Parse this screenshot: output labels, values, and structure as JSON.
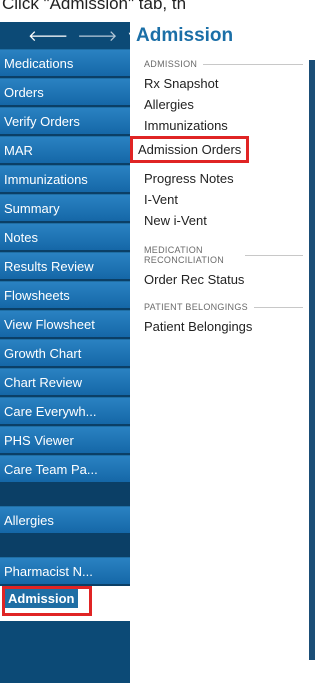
{
  "caption": "Click \"Admission\" tab, th",
  "leftnav": {
    "back_icon": "arrow-left",
    "forward_icon": "arrow-right",
    "menu_icon": "chevron-down",
    "items": [
      {
        "label": "Medications"
      },
      {
        "label": "Orders"
      },
      {
        "label": "Verify Orders"
      },
      {
        "label": "MAR"
      },
      {
        "label": "Immunizations"
      },
      {
        "label": "Summary"
      },
      {
        "label": "Notes"
      },
      {
        "label": "Results Review"
      },
      {
        "label": "Flowsheets"
      },
      {
        "label": "View Flowsheet"
      },
      {
        "label": "Growth Chart"
      },
      {
        "label": "Chart Review"
      },
      {
        "label": "Care Everywh..."
      },
      {
        "label": "PHS Viewer"
      },
      {
        "label": "Care Team Pa..."
      },
      {
        "label": "Allergies"
      },
      {
        "label": "Pharmacist N..."
      }
    ],
    "active_item": {
      "label": "Admission"
    }
  },
  "panel": {
    "title": "Admission",
    "sections": [
      {
        "label": "ADMISSION",
        "items": [
          "Rx Snapshot",
          "Allergies",
          "Immunizations",
          "Admission Orders",
          "Progress Notes",
          "I-Vent",
          "New i-Vent"
        ]
      },
      {
        "label": "MEDICATION RECONCILIATION",
        "items": [
          "Order Rec Status"
        ]
      },
      {
        "label": "PATIENT BELONGINGS",
        "items": [
          "Patient Belongings"
        ]
      }
    ]
  },
  "colors": {
    "nav_bg": "#0c4a76",
    "nav_item": "#1f74b6",
    "title_blue": "#1b6fa7",
    "highlight": "#e02424"
  }
}
